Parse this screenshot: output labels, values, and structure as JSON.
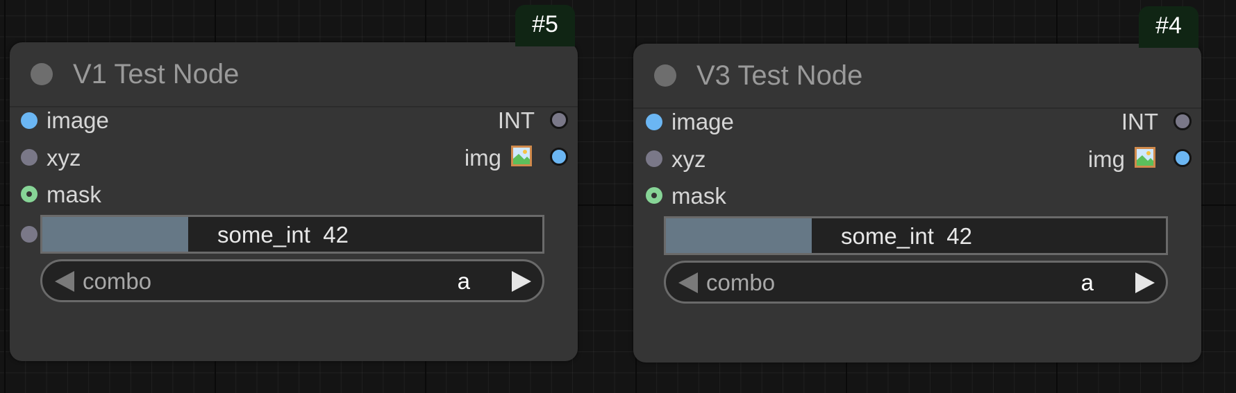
{
  "nodes": [
    {
      "badge": "#5",
      "title": "V1 Test Node",
      "inputs": [
        "image",
        "xyz",
        "mask"
      ],
      "outputs": [
        "INT",
        "img"
      ],
      "number_widget": {
        "text": "some_int  42",
        "fill_fraction": 0.33
      },
      "combo": {
        "label": "combo",
        "value": "a"
      },
      "widget_has_input_slot": true
    },
    {
      "badge": "#4",
      "title": "V3 Test Node",
      "inputs": [
        "image",
        "xyz",
        "mask"
      ],
      "outputs": [
        "INT",
        "img"
      ],
      "number_widget": {
        "text": "some_int  42",
        "fill_fraction": 0.33
      },
      "combo": {
        "label": "combo",
        "value": "a"
      },
      "widget_has_input_slot": false
    }
  ],
  "icons": {
    "title_dot": "collapse-dot-icon",
    "output_image": "framed-picture-icon"
  },
  "colors": {
    "image_slot": "#6bb6f3",
    "generic_slot": "#7a7888",
    "mask_slot": "#87d597",
    "badge_bg": "#102514",
    "node_bg": "#353535"
  }
}
